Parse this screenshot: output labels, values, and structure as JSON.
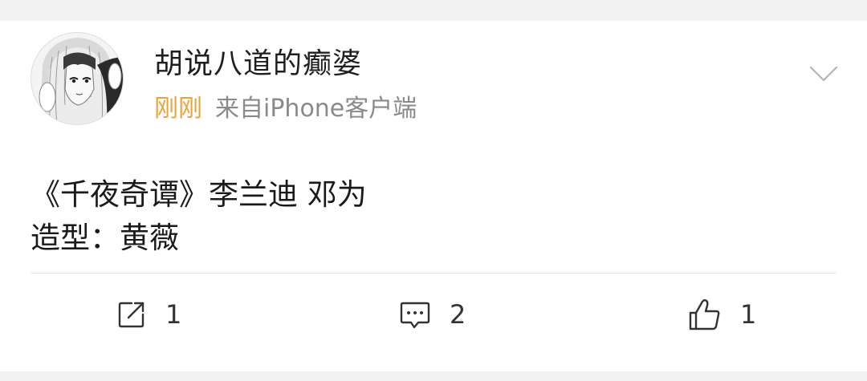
{
  "author": {
    "name": "胡说八道的癫婆",
    "avatar_icon": "anime-girl-avatar"
  },
  "meta": {
    "time": "刚刚",
    "source": "来自iPhone客户端"
  },
  "post": {
    "line1": "《千夜奇谭》李兰迪 邓为",
    "line2": "造型：黄薇"
  },
  "actions": {
    "repost_count": "1",
    "comment_count": "2",
    "like_count": "1"
  },
  "colors": {
    "time": "#e8a33a",
    "source": "#8a8a8a",
    "text": "#1a1a1a"
  }
}
